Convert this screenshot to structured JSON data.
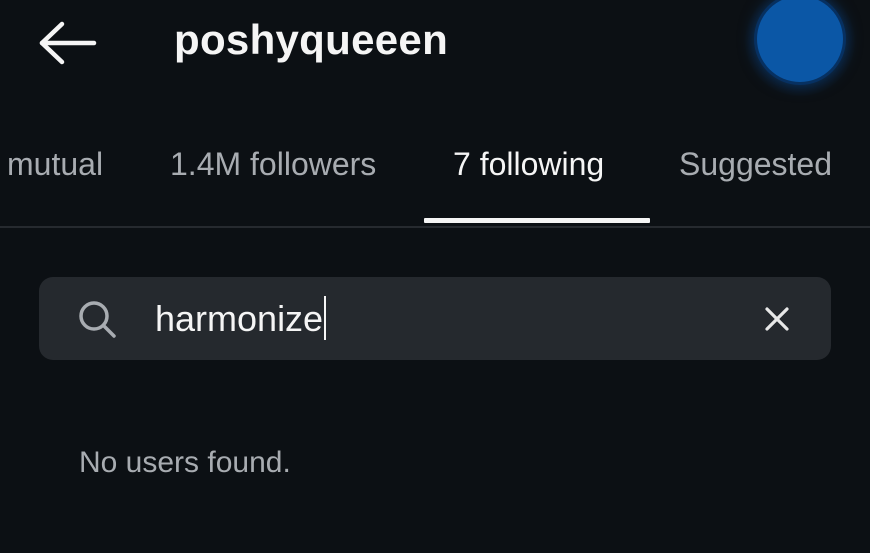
{
  "header": {
    "title": "poshyqueeen",
    "back_icon": "arrow-left-icon",
    "story_color": "#0b57a6"
  },
  "tabs": [
    {
      "label": "mutual",
      "active": false
    },
    {
      "label": "1.4M followers",
      "active": false
    },
    {
      "label": "7 following",
      "active": true
    },
    {
      "label": "Suggested",
      "active": false
    }
  ],
  "search": {
    "icon": "search-icon",
    "value": "harmonize",
    "clear_icon": "close-icon"
  },
  "results": {
    "empty_message": "No users found."
  },
  "colors": {
    "background": "#0c1014",
    "search_background": "#25292e",
    "text_primary": "#f5f5f5",
    "text_secondary": "#a8acb1"
  }
}
